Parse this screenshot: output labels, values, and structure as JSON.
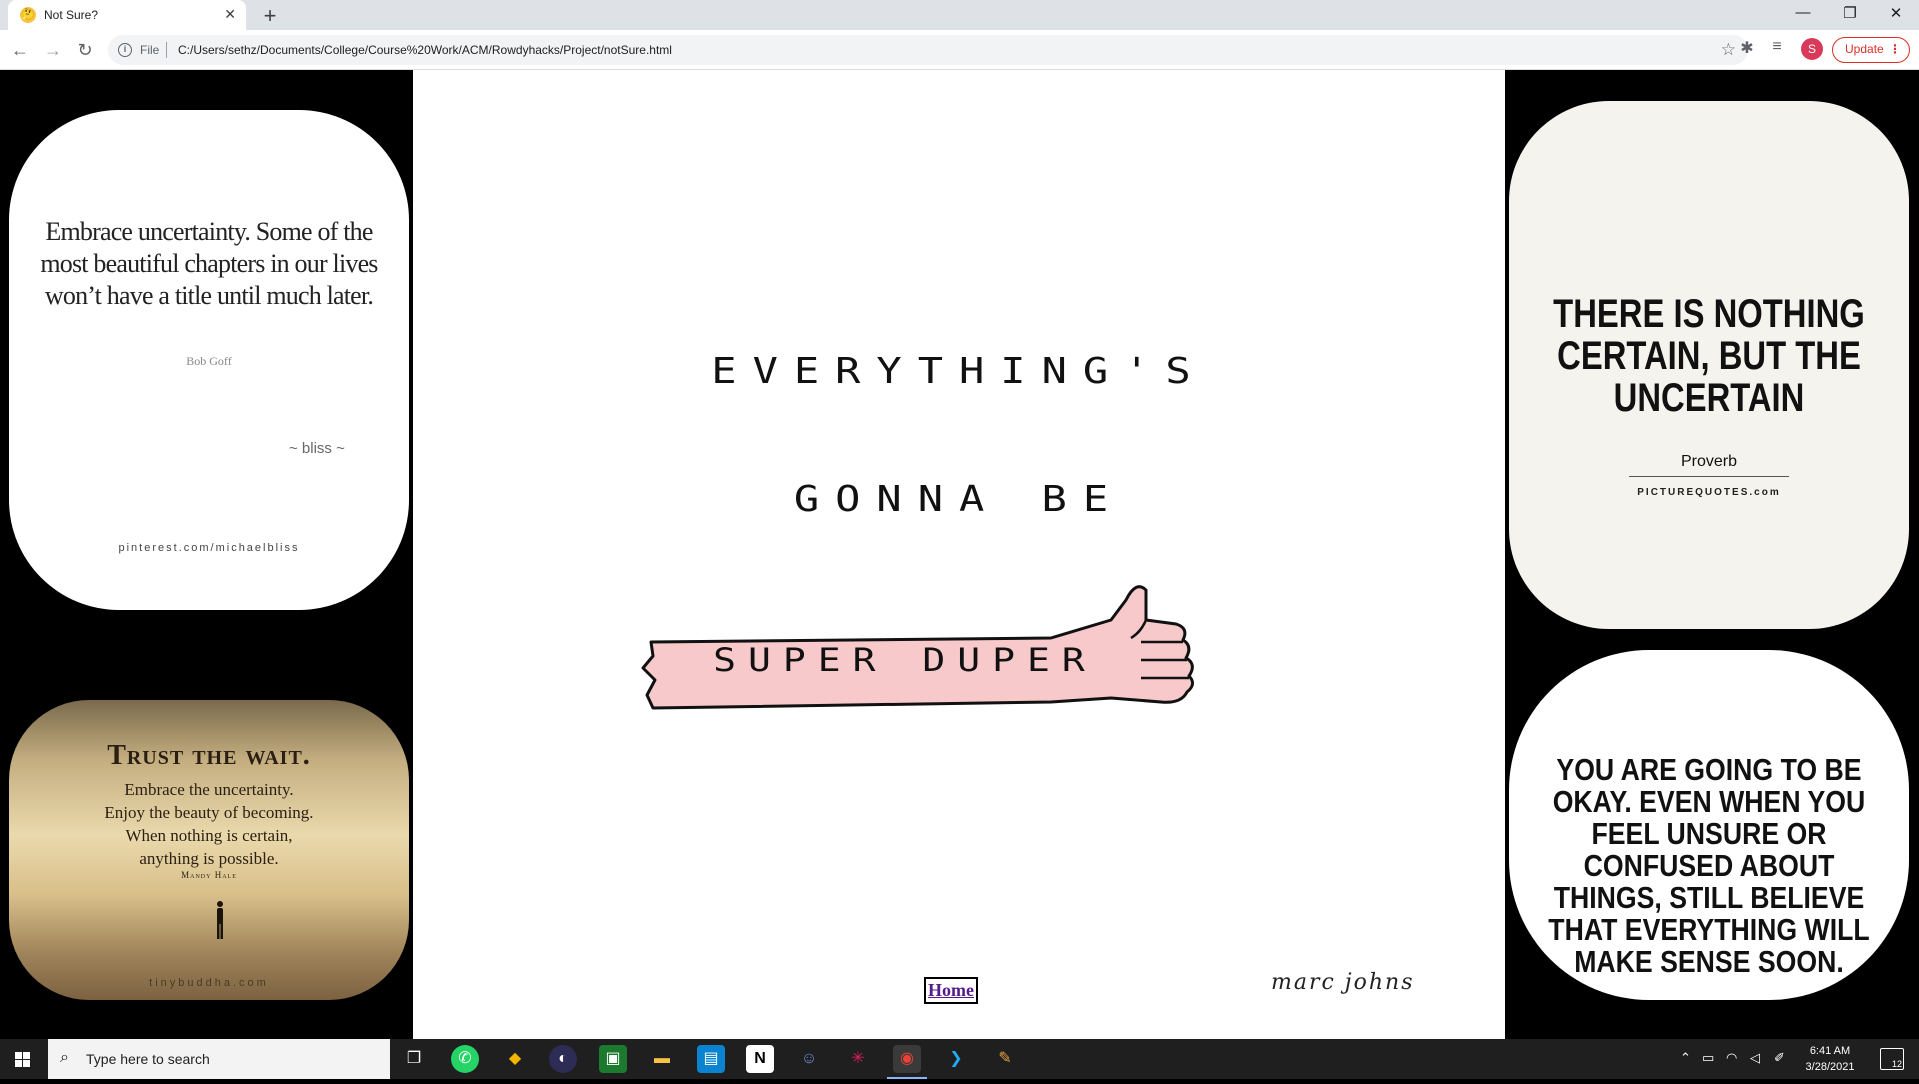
{
  "browser": {
    "tab_title": "Not Sure?",
    "tab_favicon": "🤔",
    "file_label": "File",
    "url": "C:/Users/sethz/Documents/College/Course%20Work/ACM/Rowdyhacks/Project/notSure.html",
    "profile_initial": "S",
    "update_label": "Update"
  },
  "page": {
    "top_left_card": {
      "quote": "Embrace uncertainty. Some of the most beautiful chapters in our lives won’t have a title until much later.",
      "author": "Bob Goff",
      "signature": "~ bliss ~",
      "source": "pinterest.com/michaelbliss"
    },
    "bottom_left_card": {
      "title": "Trust the wait.",
      "quote": "Embrace the uncertainty.\nEnjoy the beauty of becoming.\nWhen nothing is certain,\nanything is possible.",
      "author": "Mandy Hale",
      "source": "tinybuddha.com"
    },
    "center_image": {
      "line1": "EVERYTHING'S",
      "line2": "GONNA BE",
      "arm_text": "SUPER DUPER",
      "signature": "marc johns"
    },
    "home_link": "Home",
    "top_right_card": {
      "quote": "THERE IS NOTHING CERTAIN, BUT THE UNCERTAIN",
      "author": "Proverb",
      "source": "PICTUREQUOTES.com"
    },
    "bottom_right_card": {
      "quote": "YOU ARE GOING TO BE OKAY. EVEN WHEN YOU FEEL UNSURE OR CONFUSED ABOUT THINGS, STILL BELIEVE THAT EVERYTHING WILL MAKE SENSE SOON."
    }
  },
  "taskbar": {
    "search_placeholder": "Type here to search",
    "time": "6:41 AM",
    "date": "3/28/2021",
    "notification_count": "12"
  }
}
